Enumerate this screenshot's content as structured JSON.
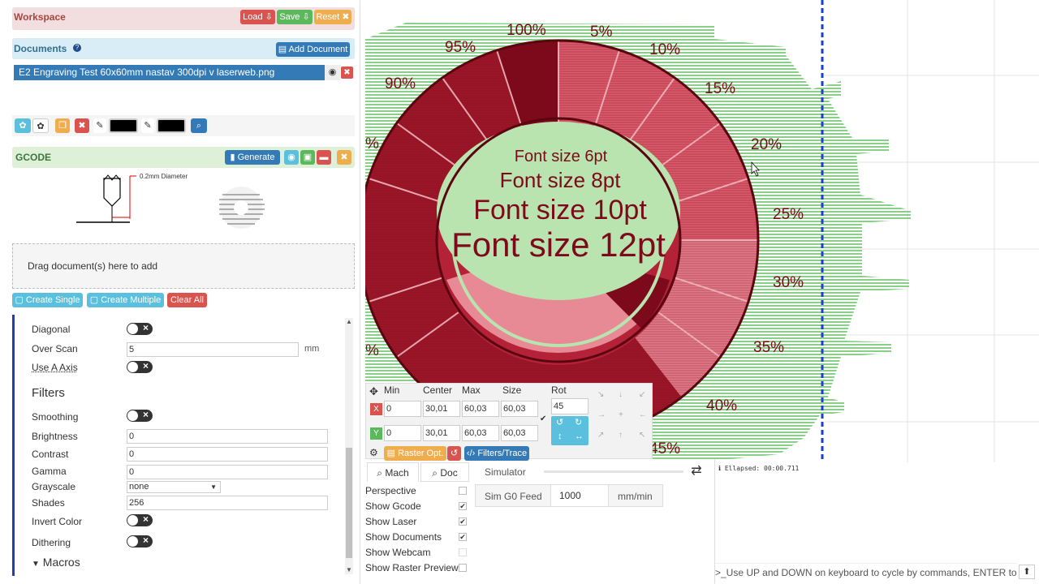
{
  "workspace": {
    "title": "Workspace",
    "load": "Load",
    "save": "Save",
    "reset": "Reset"
  },
  "documents": {
    "title": "Documents",
    "help": "?",
    "add": "Add Document",
    "file": "E2 Engraving Test 60x60mm nastav 300dpi v laserweb.png"
  },
  "gcode": {
    "title": "GCODE",
    "generate": "Generate",
    "tool_label": "0.2mm Diameter"
  },
  "drop": {
    "text": "Drag document(s) here to add",
    "single": "Create Single",
    "multiple": "Create Multiple",
    "clear": "Clear All"
  },
  "settings": {
    "diagonal": "Diagonal",
    "overscan": "Over Scan",
    "overscan_value": "5",
    "overscan_unit": "mm",
    "use_a_axis": "Use A Axis",
    "filters": "Filters",
    "smoothing": "Smoothing",
    "brightness": "Brightness",
    "brightness_value": "0",
    "contrast": "Contrast",
    "contrast_value": "0",
    "gamma": "Gamma",
    "gamma_value": "0",
    "grayscale": "Grayscale",
    "grayscale_value": "none",
    "shades": "Shades",
    "shades_value": "256",
    "invert": "Invert Color",
    "dithering": "Dithering",
    "macros": "Macros"
  },
  "canvas": {
    "center_lines": [
      "Font size 6pt",
      "Font size 8pt",
      "Font size 10pt",
      "Font size 12pt"
    ],
    "percents": [
      "100%",
      "5%",
      "95%",
      "10%",
      "90%",
      "15%",
      "20%",
      "25%",
      "30%",
      "35%",
      "40%",
      "45%",
      "%",
      "%"
    ]
  },
  "transform": {
    "headers": {
      "min": "Min",
      "center": "Center",
      "max": "Max",
      "size": "Size",
      "rot": "Rot"
    },
    "x": {
      "label": "X",
      "min": "0",
      "center": "30,01",
      "max": "60,03",
      "size": "60,03"
    },
    "y": {
      "label": "Y",
      "min": "0",
      "center": "30,01",
      "max": "60,03",
      "size": "60,03"
    },
    "rot": "45",
    "raster_opt": "Raster Opt.",
    "filters_trace": "Filters/Trace"
  },
  "view": {
    "mach": "Mach",
    "doc": "Doc",
    "simulator": "Simulator",
    "sim_feed_label": "Sim G0 Feed",
    "sim_feed_value": "1000",
    "sim_feed_unit": "mm/min",
    "options": [
      {
        "label": "Perspective",
        "checked": false
      },
      {
        "label": "Show Gcode",
        "checked": true
      },
      {
        "label": "Show Laser",
        "checked": true
      },
      {
        "label": "Show Documents",
        "checked": true
      },
      {
        "label": "Show Webcam",
        "checked": false
      },
      {
        "label": "Show Raster Preview",
        "checked": false
      }
    ],
    "check_mark": "✔"
  },
  "console": {
    "elapsed": "Ellapsed: 00:00.711",
    "hint": ">_Use UP and DOWN on keyboard to cycle by commands, ENTER to"
  },
  "colors": {
    "green": "#7fd17f",
    "red_dark": "#8b0f1e",
    "red_light": "#e88a95",
    "blue": "#337ab7"
  }
}
